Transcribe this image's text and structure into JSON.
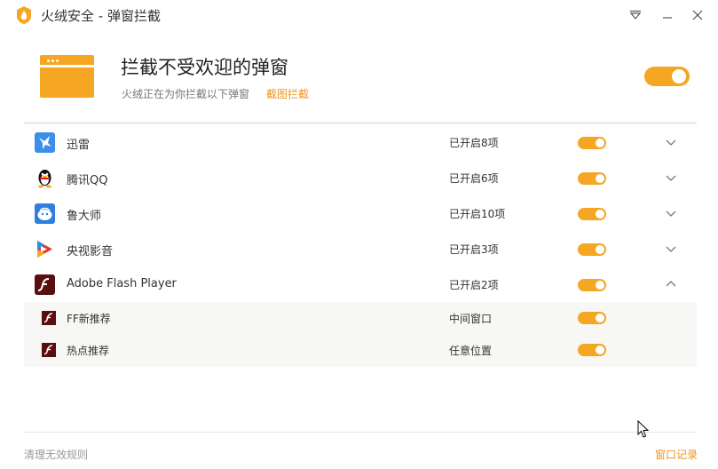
{
  "window": {
    "title": "火绒安全 - 弹窗拦截"
  },
  "header": {
    "title": "拦截不受欢迎的弹窗",
    "subtitle": "火绒正在为你拦截以下弹窗",
    "link": "截图拦截",
    "master_toggle": true
  },
  "apps": [
    {
      "name": "迅雷",
      "status": "已开启8项",
      "icon": "xunlei-icon",
      "enabled": true,
      "expanded": false
    },
    {
      "name": "腾讯QQ",
      "status": "已开启6项",
      "icon": "qq-penguin-icon",
      "enabled": true,
      "expanded": false
    },
    {
      "name": "鲁大师",
      "status": "已开启10项",
      "icon": "ludashi-icon",
      "enabled": true,
      "expanded": false
    },
    {
      "name": "央视影音",
      "status": "已开启3项",
      "icon": "cbox-icon",
      "enabled": true,
      "expanded": false
    },
    {
      "name": "Adobe Flash Player",
      "status": "已开启2项",
      "icon": "flash-icon",
      "enabled": true,
      "expanded": true
    }
  ],
  "flash_items": [
    {
      "name": "FF新推荐",
      "status": "中间窗口",
      "icon": "flash-icon",
      "enabled": true
    },
    {
      "name": "热点推荐",
      "status": "任意位置",
      "icon": "flash-icon",
      "enabled": true
    }
  ],
  "footer": {
    "left": "清理无效规则",
    "right": "窗口记录"
  },
  "colors": {
    "accent": "#f5a623",
    "link": "#f0931c"
  }
}
